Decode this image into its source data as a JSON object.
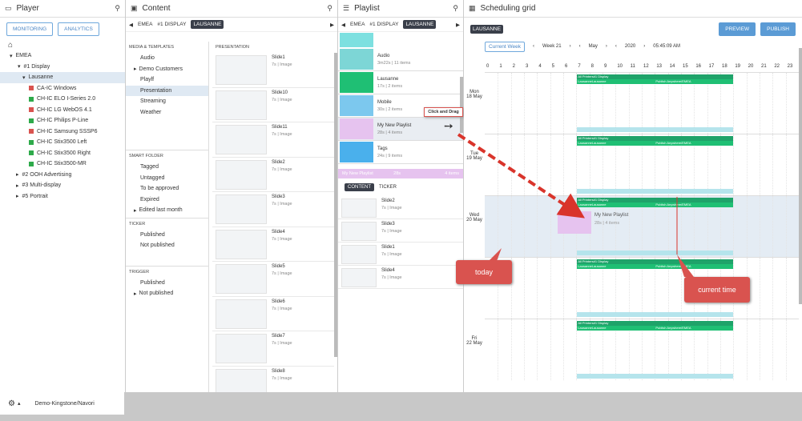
{
  "player": {
    "title": "Player",
    "monitoring": "MONITORING",
    "analytics": "ANALYTICS",
    "tree": [
      {
        "label": "EMEA",
        "indent": 12,
        "arrow": "▾",
        "color": ""
      },
      {
        "label": "#1 Display",
        "indent": 22,
        "arrow": "▾",
        "color": ""
      },
      {
        "label": "Lausanne",
        "indent": 28,
        "arrow": "▾",
        "color": "",
        "sel": true
      },
      {
        "label": "CA-IC Windows",
        "indent": 36,
        "arrow": "",
        "color": "#d9534f"
      },
      {
        "label": "CH-IC ELO I-Series 2.0",
        "indent": 36,
        "arrow": "",
        "color": "#2eaa4a"
      },
      {
        "label": "CH-IC LG WebOS 4.1",
        "indent": 36,
        "arrow": "",
        "color": "#d9534f"
      },
      {
        "label": "CH-IC Philips P-Line",
        "indent": 36,
        "arrow": "",
        "color": "#2eaa4a"
      },
      {
        "label": "CH-IC Samsung SSSP6",
        "indent": 36,
        "arrow": "",
        "color": "#d9534f"
      },
      {
        "label": "CH-IC Stix3500 Left",
        "indent": 36,
        "arrow": "",
        "color": "#2eaa4a"
      },
      {
        "label": "CH-IC Stix3500 Right",
        "indent": 36,
        "arrow": "",
        "color": "#2eaa4a"
      },
      {
        "label": "CH-IC Stix3500-MR",
        "indent": 36,
        "arrow": "",
        "color": "#2eaa4a"
      },
      {
        "label": "#2 OOH Advertising",
        "indent": 20,
        "arrow": "▸",
        "color": ""
      },
      {
        "label": "#3 Multi-display",
        "indent": 20,
        "arrow": "▸",
        "color": ""
      },
      {
        "label": "#5 Portrait",
        "indent": 20,
        "arrow": "▸",
        "color": ""
      }
    ]
  },
  "content": {
    "title": "Content",
    "crumb1": "EMEA",
    "crumb2": "#1 DISPLAY",
    "crumb3": "LAUSANNE",
    "media_header": "MEDIA & TEMPLATES",
    "media": [
      "Audio",
      "Demo Customers",
      "Playlf",
      "Presentation",
      "Streaming",
      "Weather"
    ],
    "smart_header": "SMART FOLDER",
    "smart": [
      "Tagged",
      "Untagged",
      "To be approved",
      "Expired",
      "Edited last month"
    ],
    "ticker_header": "TICKER",
    "ticker": [
      "Published",
      "Not published"
    ],
    "trigger_header": "TRIGGER",
    "trigger": [
      "Published",
      "Not published"
    ],
    "pres_header": "PRESENTATION",
    "slides": [
      {
        "name": "Slide1",
        "meta": "7s | Image"
      },
      {
        "name": "Slide10",
        "meta": "7s | Image"
      },
      {
        "name": "Slide11",
        "meta": "7s | Image"
      },
      {
        "name": "Slide2",
        "meta": "7s | Image"
      },
      {
        "name": "Slide3",
        "meta": "7s | Image"
      },
      {
        "name": "Slide4",
        "meta": "7s | Image"
      },
      {
        "name": "Slide5",
        "meta": "7s | Image"
      },
      {
        "name": "Slide6",
        "meta": "7s | Image"
      },
      {
        "name": "Slide7",
        "meta": "7s | Image"
      },
      {
        "name": "Slide8",
        "meta": "7s | Image"
      }
    ]
  },
  "playlist": {
    "title": "Playlist",
    "crumb1": "EMEA",
    "crumb2": "#1 DISPLAY",
    "crumb3": "LAUSANNE",
    "items": [
      {
        "name": "Audio",
        "meta": "3m22s | 11 items",
        "color": "#7dd6d6"
      },
      {
        "name": "Lausanne",
        "meta": "17s | 2 items",
        "color": "#1fbf74"
      },
      {
        "name": "Mobile",
        "meta": "30s | 2 items",
        "color": "#7cc8ee"
      },
      {
        "name": "My New Playlist",
        "meta": "28s | 4 items",
        "color": "#e6c3ef"
      },
      {
        "name": "Tags",
        "meta": "24s | 9 items",
        "color": "#4ab0ec"
      }
    ],
    "selected_bar": {
      "name": "My New Playlist",
      "dur": "28s",
      "count": "4 items"
    },
    "tab_content": "CONTENT",
    "tab_ticker": "TICKER",
    "slides": [
      {
        "name": "Slide2",
        "meta": "7s | Image"
      },
      {
        "name": "Slide3",
        "meta": "7s | Image"
      },
      {
        "name": "Slide1",
        "meta": "7s | Image"
      },
      {
        "name": "Slide4",
        "meta": "7s | Image"
      }
    ],
    "drag_tip": "Click and Drag"
  },
  "grid": {
    "title": "Scheduling grid",
    "location": "LAUSANNE",
    "preview": "PREVIEW",
    "publish": "PUBLISH",
    "current_week": "Current Week",
    "week": "Week 21",
    "month": "May",
    "year": "2020",
    "time": "05:45:09 AM",
    "hours": [
      "0",
      "1",
      "2",
      "3",
      "4",
      "5",
      "6",
      "7",
      "8",
      "9",
      "10",
      "11",
      "12",
      "13",
      "14",
      "15",
      "16",
      "17",
      "18",
      "19",
      "20",
      "21",
      "22",
      "23"
    ],
    "days": [
      {
        "d": "Mon",
        "n": "18 May"
      },
      {
        "d": "Tue",
        "n": "19 May"
      },
      {
        "d": "Wed",
        "n": "20 May"
      },
      {
        "d": "Thu",
        "n": "21 May"
      },
      {
        "d": "Fri",
        "n": "22 May"
      }
    ],
    "bar_top": "All Printers#1 Display",
    "bar_left": "LausanneLausanne",
    "bar_right": "Publish Anywhere/EMEA",
    "drop_name": "My New Playlist",
    "drop_meta": "28s | 4 items",
    "today": "today",
    "current_time": "current time"
  },
  "footer": {
    "user": "Demo-Kingstone/Navori"
  }
}
